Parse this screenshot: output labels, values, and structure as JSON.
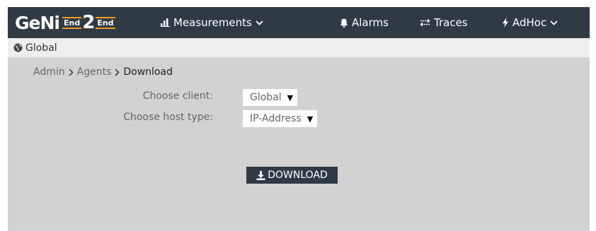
{
  "app": {
    "logo_main": "GeNi",
    "logo_end_top": "End",
    "logo_two": "2",
    "logo_end_bottom": "End"
  },
  "nav": {
    "measurements": "Measurements",
    "alarms": "Alarms",
    "traces": "Traces",
    "adhoc": "AdHoc"
  },
  "subbar": {
    "scope": "Global"
  },
  "breadcrumb": [
    "Admin",
    "Agents",
    "Download"
  ],
  "form": {
    "client_label": "Choose client:",
    "client_value": "Global",
    "host_type_label": "Choose host type:",
    "host_type_value": "IP-Address"
  },
  "actions": {
    "download_label": "DOWNLOAD"
  },
  "colors": {
    "topbar": "#2f3a45",
    "content_bg": "#d2d2d2",
    "subbar_bg": "#eeeeee",
    "logo_accent": "#f29a1e"
  },
  "icons": {
    "measurements": "bar-chart-icon",
    "alarms": "bell-icon",
    "traces": "exchange-icon",
    "adhoc": "bolt-icon",
    "scope": "globe-icon",
    "download": "download-icon"
  }
}
